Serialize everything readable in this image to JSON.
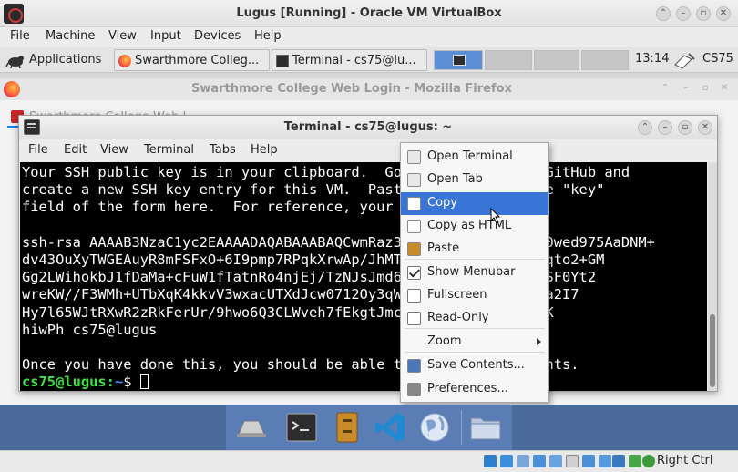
{
  "vbox": {
    "title": "Lugus [Running] - Oracle VM VirtualBox",
    "menu": [
      "File",
      "Machine",
      "View",
      "Input",
      "Devices",
      "Help"
    ],
    "host_key_label": "Right Ctrl"
  },
  "panel": {
    "applications_label": "Applications",
    "tasks": [
      {
        "label": "Swarthmore Colleg...",
        "icon": "firefox-icon"
      },
      {
        "label": "Terminal - cs75@lu...",
        "icon": "terminal-icon"
      }
    ],
    "clock": "13:14",
    "user": "CS75"
  },
  "firefox": {
    "title": "Swarthmore College Web Login - Mozilla Firefox",
    "tab_label": "Swarthmore College Web L..."
  },
  "terminal": {
    "title": "Terminal - cs75@lugus: ~",
    "menu": [
      "File",
      "Edit",
      "View",
      "Terminal",
      "Tabs",
      "Help"
    ],
    "lines": [
      "Your SSH public key is in your clipboard.  Go to Swarthmore's GitHub and",
      "create a new SSH key entry for this VM.  Paste the key into the \"key\"",
      "field of the form here.  For reference, your key's text is:",
      "",
      "ssh-rsa AAAAB3NzaC1yc2EAAAADAQABAAABAQCwmRaz3nkrK2L9HPJqFtG4X20wed975AaDNM+",
      "dv43OuXyTWGEAuyR8mFSFxO+6I9pmp7RPqkXrwAp/JhMTzxkLUXjLLyiQEODXFqto2+GM",
      "Gg2LWihokbJ1fDaMa+cFuW1fTatnRo4njEj/TzNJsJmd6Yt7aDjcrMkzzCv+AsSF0Yt2",
      "wreKW//F3WMh+UTbXqK4kkvV3wxacUTXdJcw0712Oy3qWpTfaDBbswJeE43xfOa2I7",
      "Hy7l65WJtRXwR2zRkFerUr/9hwo6Q3CLWveh7fEkgtJmcUvufHaqDPJTunTvIFK",
      "hiwPh cs75@lugus",
      "",
      "Once you have done this, you should be able to do lab assignments."
    ],
    "highlighted_line_indices": [
      3,
      10
    ],
    "prompt_user": "cs75@lugus",
    "prompt_sep": ":",
    "prompt_path": "~",
    "prompt_symbol": "$ "
  },
  "context_menu": {
    "items": [
      {
        "label": "Open Terminal",
        "icon": "new-terminal-icon"
      },
      {
        "label": "Open Tab",
        "icon": "new-tab-icon"
      },
      {
        "label": "Copy",
        "icon": "copy-icon",
        "active": true
      },
      {
        "label": "Copy as HTML",
        "icon": "copy-html-icon"
      },
      {
        "label": "Paste",
        "icon": "paste-icon"
      },
      {
        "label": "Show Menubar",
        "checkbox": true,
        "checked": true
      },
      {
        "label": "Fullscreen",
        "checkbox": true,
        "checked": false
      },
      {
        "label": "Read-Only",
        "checkbox": true,
        "checked": false
      },
      {
        "label": "Zoom",
        "submenu": true
      },
      {
        "label": "Save Contents...",
        "icon": "save-icon"
      },
      {
        "label": "Preferences...",
        "icon": "preferences-icon"
      }
    ]
  },
  "dock": {
    "items": [
      "show-desktop-icon",
      "terminal-icon",
      "file-manager-icon",
      "vscode-icon",
      "web-browser-icon",
      "folder-icon"
    ]
  },
  "colors": {
    "selection": "#3875d7",
    "prompt_user": "#3ee43e",
    "prompt_path": "#4a8bff",
    "dock": "#5b7db5"
  }
}
